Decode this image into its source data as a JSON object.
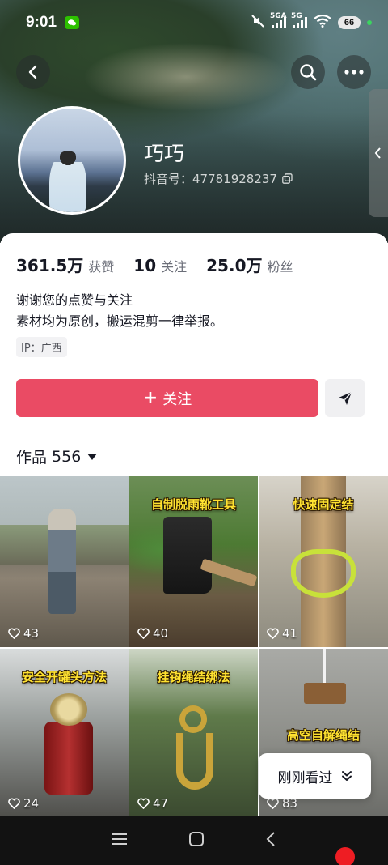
{
  "status_bar": {
    "time": "9:01",
    "net_1": "5GA",
    "net_2": "5G",
    "battery": "66"
  },
  "profile": {
    "name": "巧巧",
    "id_text": "抖音号：47781928237",
    "stats": [
      {
        "value": "361.5万",
        "label": "获赞"
      },
      {
        "value": "10",
        "label": "关注"
      },
      {
        "value": "25.0万",
        "label": "粉丝"
      }
    ],
    "bio_line_1": "谢谢您的点赞与关注",
    "bio_line_2": "素材均为原创，搬运混剪一律举报。",
    "ip": "IP：广西"
  },
  "actions": {
    "follow_label": "关注"
  },
  "works": {
    "label": "作品",
    "count": "556",
    "tiles": [
      {
        "title": "",
        "likes": "43"
      },
      {
        "title": "自制脱雨靴工具",
        "likes": "40"
      },
      {
        "title": "快速固定结",
        "likes": "41"
      },
      {
        "title": "安全开罐头方法",
        "likes": "24"
      },
      {
        "title": "挂钩绳结绑法",
        "likes": "47"
      },
      {
        "title": "高空自解绳结",
        "likes": "83"
      }
    ]
  },
  "recent_chip": {
    "label": "刚刚看过"
  },
  "colors": {
    "accent": "#ea4b64",
    "caption": "#ffe230"
  }
}
